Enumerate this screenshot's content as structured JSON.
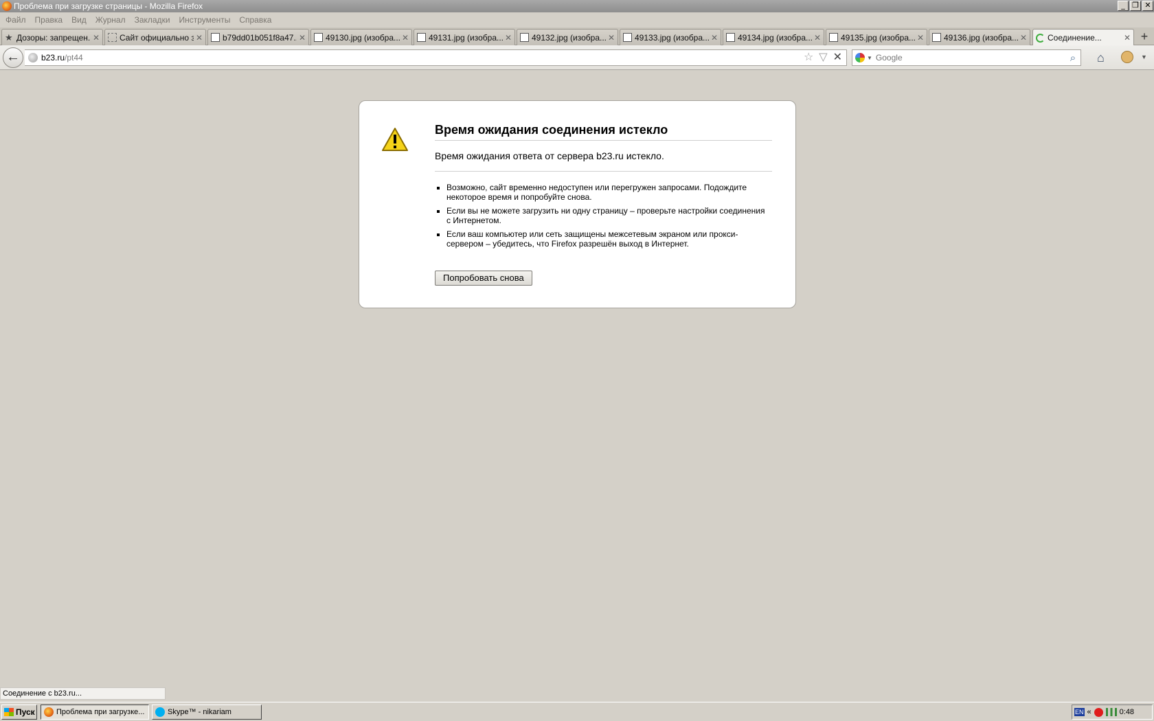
{
  "window": {
    "title": "Проблема при загрузке страницы - Mozilla Firefox",
    "min_glyph": "_",
    "max_glyph": "❐",
    "close_glyph": "✕"
  },
  "menu": [
    "Файл",
    "Правка",
    "Вид",
    "Журнал",
    "Закладки",
    "Инструменты",
    "Справка"
  ],
  "tabs": [
    {
      "label": "Дозоры: запрещен...",
      "icon": "star-icon"
    },
    {
      "label": "Сайт официально з...",
      "icon": "dashed-page-icon"
    },
    {
      "label": "b79dd01b051f8a47...",
      "icon": "image-icon"
    },
    {
      "label": "49130.jpg (изобра...",
      "icon": "image-icon"
    },
    {
      "label": "49131.jpg (изобра...",
      "icon": "image-icon"
    },
    {
      "label": "49132.jpg (изобра...",
      "icon": "image-icon"
    },
    {
      "label": "49133.jpg (изобра...",
      "icon": "image-icon"
    },
    {
      "label": "49134.jpg (изобра...",
      "icon": "image-icon"
    },
    {
      "label": "49135.jpg (изобра...",
      "icon": "image-icon"
    },
    {
      "label": "49136.jpg (изобра...",
      "icon": "image-icon"
    },
    {
      "label": "Соединение...",
      "icon": "loading-icon",
      "active": true
    }
  ],
  "tab_close_glyph": "✕",
  "new_tab_glyph": "+",
  "nav": {
    "back_glyph": "←",
    "url_host": "b23.ru",
    "url_path": "/pt44",
    "star_glyph": "☆",
    "dropdown_glyph": "▽",
    "stop_glyph": "✕",
    "search_placeholder": "Google",
    "search_glyph": "⌕",
    "home_glyph": "⌂",
    "menu_glyph": "▼"
  },
  "error": {
    "title": "Время ожидания соединения истекло",
    "description": "Время ожидания ответа от сервера b23.ru истекло.",
    "items": [
      "Возможно, сайт временно недоступен или перегружен запросами. Подождите некоторое время и попробуйте снова.",
      "Если вы не можете загрузить ни одну страницу – проверьте настройки соединения с Интернетом.",
      "Если ваш компьютер или сеть защищены межсетевым экраном или прокси-сервером – убедитесь, что Firefox разрешён выход в Интернет."
    ],
    "retry_label": "Попробовать снова"
  },
  "status_text": "Соединение с b23.ru...",
  "taskbar": {
    "start_label": "Пуск",
    "buttons": [
      {
        "label": "Проблема при загрузке...",
        "icon": "firefox-icon",
        "pressed": true
      },
      {
        "label": "Skype™ - nikariam",
        "icon": "skype-icon",
        "pressed": false
      }
    ],
    "lang": "EN",
    "chevron": "«",
    "clock": "0:48"
  },
  "colors": {
    "chrome": "#d4d0c8",
    "warning_yellow": "#f5d319",
    "firefox_orange": "#e8731a",
    "skype_blue": "#00aff0"
  }
}
